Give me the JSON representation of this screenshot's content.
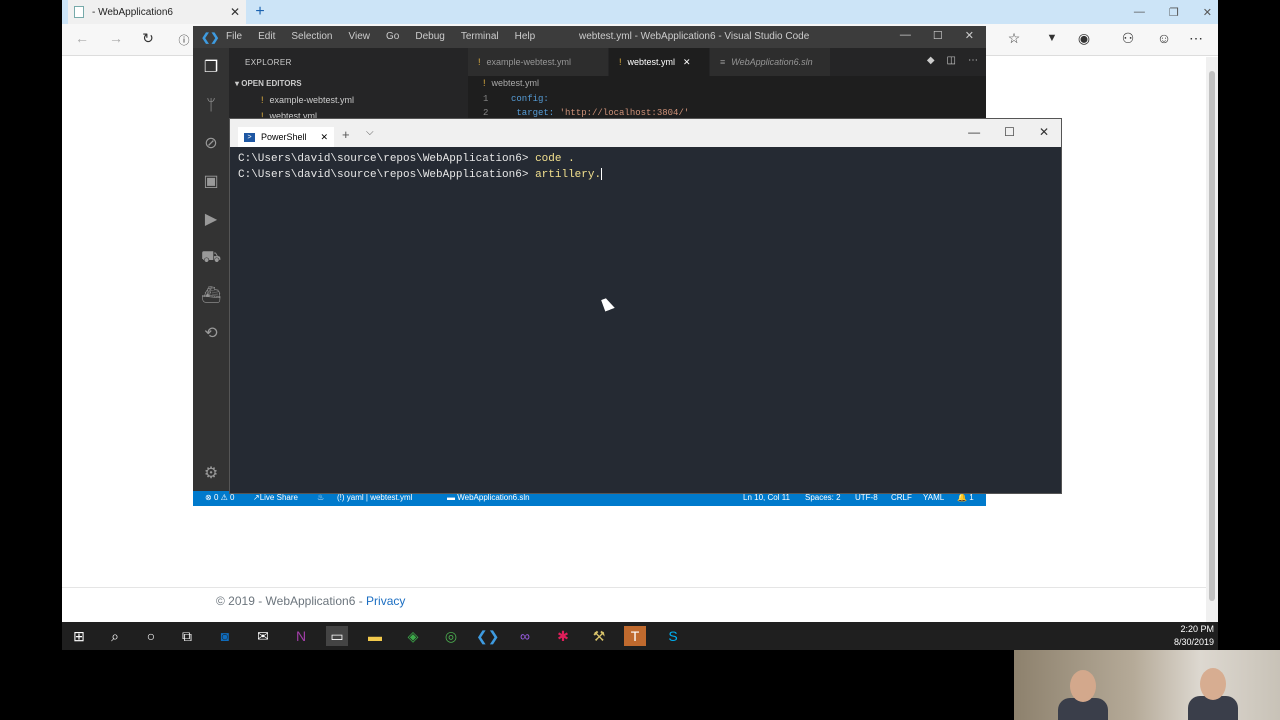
{
  "browser": {
    "tab_title": "- WebApplication6",
    "tab_close": "✕",
    "new_tab": "+",
    "window_controls": [
      "—",
      "❐",
      "✕"
    ],
    "footer": {
      "copyright": "© 2019 - WebApplication6 - ",
      "privacy": "Privacy"
    }
  },
  "vscode": {
    "menu": [
      "File",
      "Edit",
      "Selection",
      "View",
      "Go",
      "Debug",
      "Terminal",
      "Help"
    ],
    "window_title": "webtest.yml - WebApplication6 - Visual Studio Code",
    "sidebar": {
      "header": "EXPLORER",
      "section": "OPEN EDITORS",
      "items": [
        "example-webtest.yml",
        "webtest.yml"
      ]
    },
    "tabs": [
      {
        "label": "example-webtest.yml"
      },
      {
        "label": "webtest.yml",
        "close": "✕"
      },
      {
        "label": "WebApplication6.sln"
      }
    ],
    "breadcrumb": "webtest.yml",
    "code": [
      {
        "num": "1",
        "key": "config:",
        "value": ""
      },
      {
        "num": "2",
        "key": "  target:",
        "value": " 'http://localhost:3804/'"
      }
    ],
    "status": {
      "errors": "0",
      "warnings": "0",
      "live_share": "Live Share",
      "yaml": "yaml",
      "file": "webtest.yml",
      "sln": "WebApplication6.sln",
      "position": "Ln 10, Col 11",
      "spaces": "Spaces: 2",
      "encoding": "UTF-8",
      "eol": "CRLF",
      "language": "YAML",
      "notifications": "1"
    }
  },
  "powershell": {
    "tab_label": "PowerShell",
    "tab_close": "✕",
    "add_tab": "+",
    "dropdown": "⌵",
    "lines": [
      {
        "prompt": "C:\\Users\\david\\source\\repos\\WebApplication6> ",
        "command": "code ."
      },
      {
        "prompt": "C:\\Users\\david\\source\\repos\\WebApplication6> ",
        "command": "artillery."
      }
    ]
  },
  "taskbar": {
    "time": "2:20 PM",
    "date": "8/30/2019"
  }
}
